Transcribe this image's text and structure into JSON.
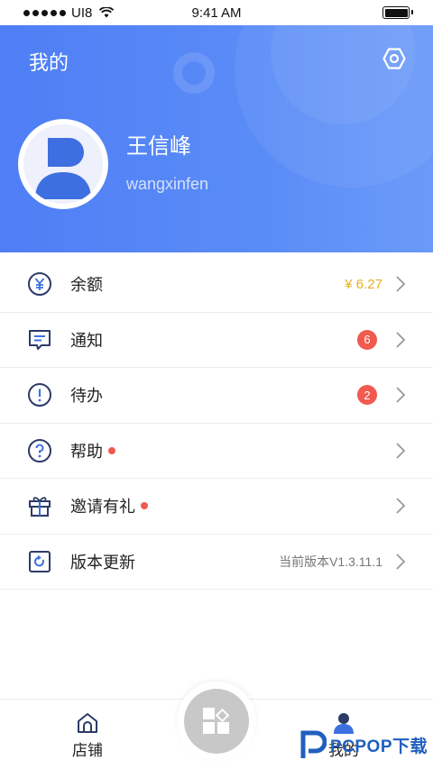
{
  "status_bar": {
    "carrier": "UI8",
    "time": "9:41 AM"
  },
  "header": {
    "title": "我的",
    "user_name": "王信峰",
    "user_id": "wangxinfen"
  },
  "menu": {
    "items": [
      {
        "label": "余额",
        "icon": "yen-coin-icon",
        "value": "¥ 6.27"
      },
      {
        "label": "通知",
        "icon": "message-icon",
        "badge": "6"
      },
      {
        "label": "待办",
        "icon": "exclamation-icon",
        "badge": "2"
      },
      {
        "label": "帮助",
        "icon": "question-icon",
        "dot": true
      },
      {
        "label": "邀请有礼",
        "icon": "gift-icon",
        "dot": true
      },
      {
        "label": "版本更新",
        "icon": "update-icon",
        "value": "当前版本V1.3.11.1"
      }
    ]
  },
  "tabbar": {
    "store_label": "店铺",
    "mine_label": "我的"
  },
  "watermark": {
    "text": "PCPOP下载"
  },
  "colors": {
    "header_blue": "#5585f6",
    "balance_gold": "#e8b020",
    "badge_red": "#f05a4f",
    "icon_navy": "#2c3a66"
  }
}
